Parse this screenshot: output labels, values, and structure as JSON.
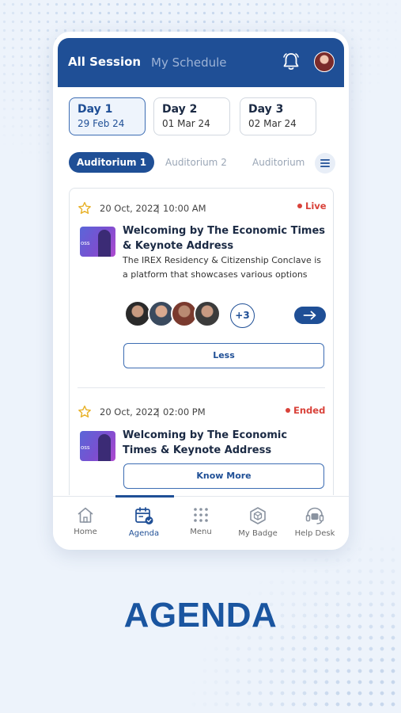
{
  "header": {
    "tab_all": "All Session",
    "tab_my": "My Schedule",
    "bell_icon": "bell-icon",
    "avatar_icon": "user-avatar"
  },
  "days": [
    {
      "label": "Day 1",
      "date": "29 Feb 24"
    },
    {
      "label": "Day 2",
      "date": "01 Mar 24"
    },
    {
      "label": "Day 3",
      "date": "02 Mar 24"
    }
  ],
  "auditoriums": [
    "Auditorium 1",
    "Auditorium 2",
    "Auditorium"
  ],
  "sessions": [
    {
      "date": "20 Oct, 2022",
      "separator": "|",
      "time": "10:00 AM",
      "status": "Live",
      "thumb_text": "oss",
      "title_line1": "Welcoming by The Economic Times",
      "title_line2": "& Keynote Address",
      "desc_line1": "The IREX Residency & Citizenship Conclave is",
      "desc_line2": "a platform that showcases various options",
      "more_speakers": "+3",
      "button": "Less"
    },
    {
      "date": "20 Oct, 2022",
      "separator": "|",
      "time": "02:00 PM",
      "status": "Ended",
      "thumb_text": "oss",
      "title_line1": "Welcoming by The Economic",
      "title_line2": "Times & Keynote Address",
      "button": "Know More"
    }
  ],
  "nav": [
    {
      "label": "Home",
      "icon": "home-icon"
    },
    {
      "label": "Agenda",
      "icon": "calendar-icon"
    },
    {
      "label": "Menu",
      "icon": "grid-icon"
    },
    {
      "label": "My Badge",
      "icon": "badge-icon"
    },
    {
      "label": "Help Desk",
      "icon": "headset-icon"
    }
  ],
  "headline": "AGENDA",
  "colors": {
    "primary": "#1f4f96",
    "live": "#d9423a",
    "headline": "#1a55a0",
    "star": "#e8b22a"
  }
}
